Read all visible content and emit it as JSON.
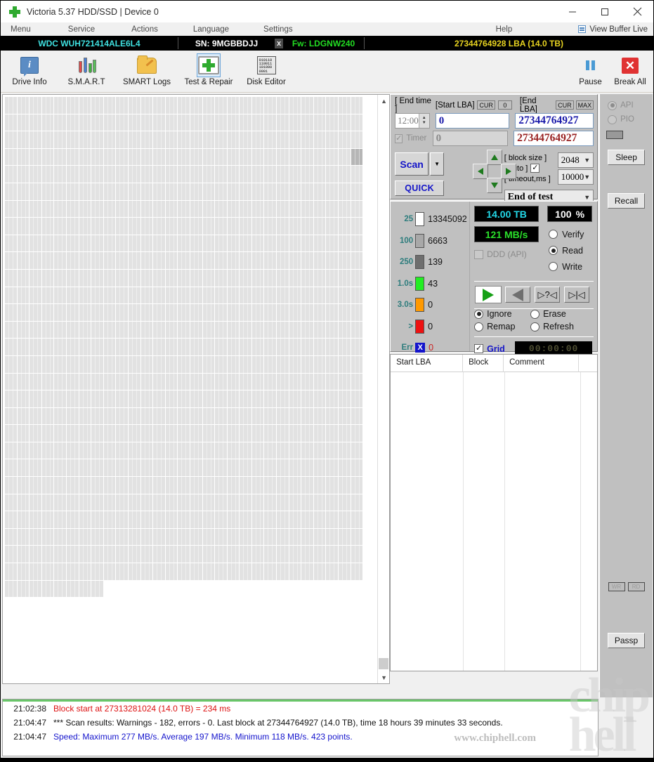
{
  "window": {
    "title": "Victoria 5.37 HDD/SSD | Device 0",
    "app_icon": "green-cross-icon",
    "minimize": "–",
    "maximize": "□",
    "close": "✕"
  },
  "menu": {
    "items": [
      {
        "label": "Menu"
      },
      {
        "label": "Service"
      },
      {
        "label": "Actions"
      },
      {
        "label": "Language"
      },
      {
        "label": "Settings"
      },
      {
        "label": "Help"
      }
    ],
    "view_buffer_live": "View Buffer Live"
  },
  "drivebar": {
    "model": "WDC  WUH721414ALE6L4",
    "serial": "SN: 9MGBBDJJ",
    "close_x": "x",
    "firmware": "Fw: LDGNW240",
    "capacity": "27344764928 LBA (14.0 TB)",
    "color_model": "#3fe0e0",
    "color_serial": "#ffffff",
    "color_fw": "#22dd22",
    "color_capacity": "#e8d320"
  },
  "toolbar": {
    "buttons": [
      {
        "label": "Drive Info",
        "icon": "info-icon",
        "selected": false
      },
      {
        "label": "S.M.A.R.T",
        "icon": "test-tubes-icon",
        "selected": false
      },
      {
        "label": "SMART Logs",
        "icon": "folder-pencil-icon",
        "selected": false
      },
      {
        "label": "Test & Repair",
        "icon": "green-cross-icon",
        "selected": true
      },
      {
        "label": "Disk Editor",
        "icon": "binary-page-icon",
        "selected": false
      }
    ],
    "right_buttons": [
      {
        "label": "Pause",
        "icon": "pause-icon"
      },
      {
        "label": "Break All",
        "icon": "red-x-icon"
      }
    ],
    "binary_lines": [
      "010110",
      "110011",
      "101000",
      "0001"
    ]
  },
  "scan_panel": {
    "end_time_label": "[ End time ]",
    "end_time_value": "12:00",
    "start_lba_label": "[Start LBA]",
    "start_lba_cur": "CUR",
    "start_lba_zero": "0",
    "start_lba_value": "0",
    "end_lba_label": "[End LBA]",
    "end_lba_cur": "CUR",
    "end_lba_max": "MAX",
    "end_lba_value": "27344764927",
    "timer_label": "Timer",
    "timer_checked": true,
    "timer_value": "0",
    "end_lba_secondary": "27344764927",
    "scan_button": "Scan",
    "scan_dropdown_caret": "▼",
    "quick_button": "QUICK",
    "nav_up": "up-arrow-icon",
    "nav_down": "down-arrow-icon",
    "nav_left": "left-arrow-icon",
    "nav_right": "right-arrow-icon",
    "block_size_label": "[ block size ]",
    "block_size_value": "2048",
    "auto_label": "[ auto ]",
    "auto_checked": true,
    "timeout_label": "[ timeout,ms ]",
    "timeout_value": "10000",
    "end_of_test_value": "End of test"
  },
  "legend": {
    "rows": [
      {
        "key": "25",
        "color": "#ffffff",
        "count": "13345092"
      },
      {
        "key": "100",
        "color": "#a8a8a8",
        "count": "6663"
      },
      {
        "key": "250",
        "color": "#6e6e6e",
        "count": "139"
      },
      {
        "key": "1.0s",
        "color": "#22ee22",
        "count": "43"
      },
      {
        "key": "3.0s",
        "color": "#ff9900",
        "count": "0"
      },
      {
        "key": ">",
        "color": "#ee1111",
        "count": "0"
      },
      {
        "key": "Err",
        "color": "#1414cc",
        "count": "0",
        "glyph": "X",
        "is_error": true
      }
    ]
  },
  "status": {
    "capacity_led": "14.00 TB",
    "percent_value": "100",
    "percent_unit": "%",
    "speed_led": "121 MB/s",
    "ddd_api_label": "DDD (API)",
    "ddd_api_checked": false,
    "modes": [
      {
        "label": "Verify",
        "selected": false
      },
      {
        "label": "Read",
        "selected": true
      },
      {
        "label": "Write",
        "selected": false
      }
    ],
    "transport": [
      {
        "icon": "play-icon",
        "active": true
      },
      {
        "icon": "play-reverse-icon",
        "active": false
      },
      {
        "icon": "scan-question-icon",
        "active": false
      },
      {
        "icon": "scan-end-icon",
        "active": false
      }
    ],
    "actions": [
      {
        "label": "Ignore",
        "selected": true
      },
      {
        "label": "Erase",
        "selected": false
      },
      {
        "label": "Remap",
        "selected": false
      },
      {
        "label": "Refresh",
        "selected": false
      }
    ],
    "grid_label": "Grid",
    "grid_checked": true,
    "clock_value": "00:00:00"
  },
  "defect_table": {
    "columns": [
      "Start LBA",
      "Block",
      "Comment"
    ],
    "rows": []
  },
  "rail": {
    "api_label": "API",
    "api_selected": true,
    "pio_label": "PIO",
    "pio_selected": false,
    "sleep_button": "Sleep",
    "recall_button": "Recall",
    "wr_button": "WR",
    "rd_button": "RD",
    "passp_button": "Passp"
  },
  "log": {
    "entries": [
      {
        "time": "21:02:38",
        "message": "Block start at 27313281024 (14.0 TB)  = 234 ms",
        "color": "red"
      },
      {
        "time": "21:04:47",
        "message": "*** Scan results: Warnings - 182, errors - 0. Last block at 27344764927 (14.0 TB), time 18 hours 39 minutes 33 seconds.",
        "color": "black"
      },
      {
        "time": "21:04:47",
        "message": "Speed: Maximum 277 MB/s. Average 197 MB/s. Minimum 118 MB/s. 423 points.",
        "color": "blue"
      }
    ],
    "watermark": "www.chiphell.com"
  }
}
